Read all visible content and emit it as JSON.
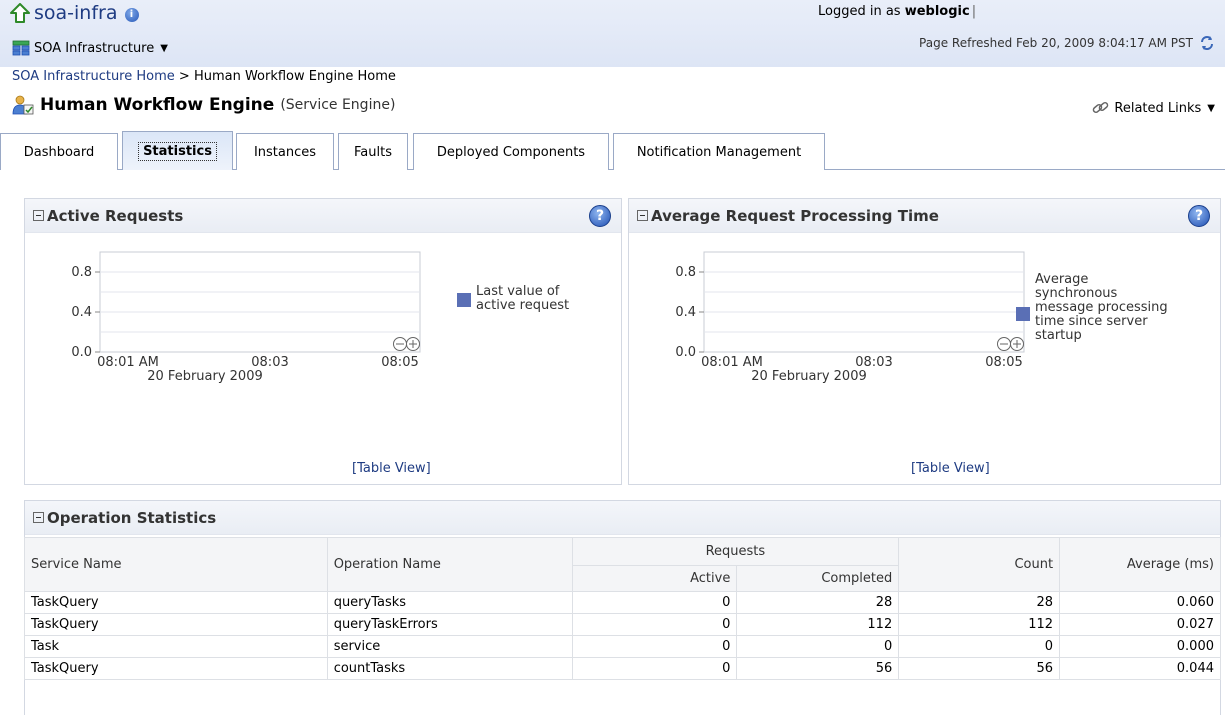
{
  "header": {
    "app_title": "soa-infra",
    "menu_label": "SOA Infrastructure",
    "logged_in_prefix": "Logged in as",
    "username": "weblogic",
    "refreshed": "Page Refreshed Feb 20, 2009 8:04:17 AM PST"
  },
  "breadcrumb": {
    "home": "SOA Infrastructure Home",
    "separator": " > ",
    "current": "Human Workflow Engine Home"
  },
  "page": {
    "title": "Human Workflow Engine",
    "subtitle": "(Service Engine)",
    "related_links": "Related Links"
  },
  "tabs": [
    {
      "label": "Dashboard",
      "active": false
    },
    {
      "label": "Statistics",
      "active": true
    },
    {
      "label": "Instances",
      "active": false
    },
    {
      "label": "Faults",
      "active": false
    },
    {
      "label": "Deployed Components",
      "active": false
    },
    {
      "label": "Notification Management",
      "active": false
    }
  ],
  "panels": {
    "active_requests": {
      "title": "Active Requests",
      "legend": [
        "Last value of",
        "active request"
      ],
      "table_view": "[Table View]"
    },
    "avg_time": {
      "title": "Average Request Processing Time",
      "legend": [
        "Average",
        "synchronous",
        "message processing",
        "time since server",
        "startup"
      ],
      "table_view": "[Table View]"
    },
    "operations": {
      "title": "Operation Statistics"
    }
  },
  "chart_data": [
    {
      "type": "line",
      "title": "Active Requests",
      "x_ticks": [
        "08:01 AM",
        "08:03",
        "08:05"
      ],
      "x_sublabel": "20 February 2009",
      "y_ticks": [
        "0.0",
        "0.4",
        "0.8"
      ],
      "ylim": [
        0,
        1
      ],
      "series": [
        {
          "name": "Last value of active request",
          "values": []
        }
      ],
      "legend_position": "right",
      "grid": true
    },
    {
      "type": "line",
      "title": "Average Request Processing Time",
      "x_ticks": [
        "08:01 AM",
        "08:03",
        "08:05"
      ],
      "x_sublabel": "20 February 2009",
      "y_ticks": [
        "0.0",
        "0.4",
        "0.8"
      ],
      "ylim": [
        0,
        1
      ],
      "series": [
        {
          "name": "Average synchronous message processing time since server startup",
          "values": []
        }
      ],
      "legend_position": "right",
      "grid": true
    }
  ],
  "table": {
    "headers": {
      "service_name": "Service Name",
      "operation_name": "Operation Name",
      "requests": "Requests",
      "active": "Active",
      "completed": "Completed",
      "count": "Count",
      "average": "Average (ms)"
    },
    "rows": [
      {
        "service": "TaskQuery",
        "operation": "queryTasks",
        "active": "0",
        "completed": "28",
        "count": "28",
        "average": "0.060"
      },
      {
        "service": "TaskQuery",
        "operation": "queryTaskErrors",
        "active": "0",
        "completed": "112",
        "count": "112",
        "average": "0.027"
      },
      {
        "service": "Task",
        "operation": "service",
        "active": "0",
        "completed": "0",
        "count": "0",
        "average": "0.000"
      },
      {
        "service": "TaskQuery",
        "operation": "countTasks",
        "active": "0",
        "completed": "56",
        "count": "56",
        "average": "0.044"
      }
    ]
  },
  "colors": {
    "link": "#1e3b82",
    "series": "#5a6fb5",
    "help": "#1f4fb2"
  }
}
